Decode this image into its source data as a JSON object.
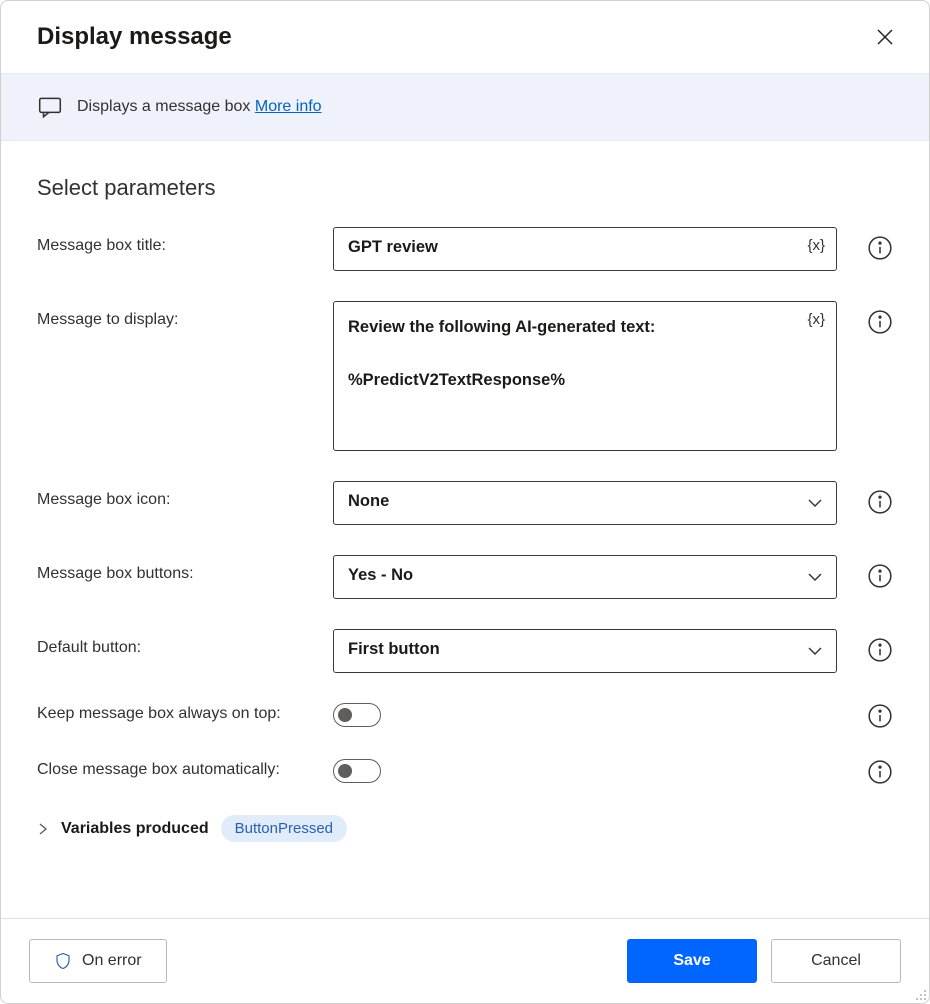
{
  "header": {
    "title": "Display message"
  },
  "banner": {
    "text": "Displays a message box",
    "link_label": "More info"
  },
  "section": {
    "title": "Select parameters"
  },
  "fields": {
    "title": {
      "label": "Message box title:",
      "value": "GPT review"
    },
    "message": {
      "label": "Message to display:",
      "value": "Review the following AI-generated text:\n\n%PredictV2TextResponse%"
    },
    "icon": {
      "label": "Message box icon:",
      "value": "None"
    },
    "buttons": {
      "label": "Message box buttons:",
      "value": "Yes - No"
    },
    "default_button": {
      "label": "Default button:",
      "value": "First button"
    },
    "always_on_top": {
      "label": "Keep message box always on top:",
      "value": false
    },
    "close_auto": {
      "label": "Close message box automatically:",
      "value": false
    }
  },
  "variables": {
    "label": "Variables produced",
    "items": [
      "ButtonPressed"
    ]
  },
  "footer": {
    "on_error": "On error",
    "save": "Save",
    "cancel": "Cancel"
  },
  "tokens": {
    "var_brace": "{x}"
  }
}
